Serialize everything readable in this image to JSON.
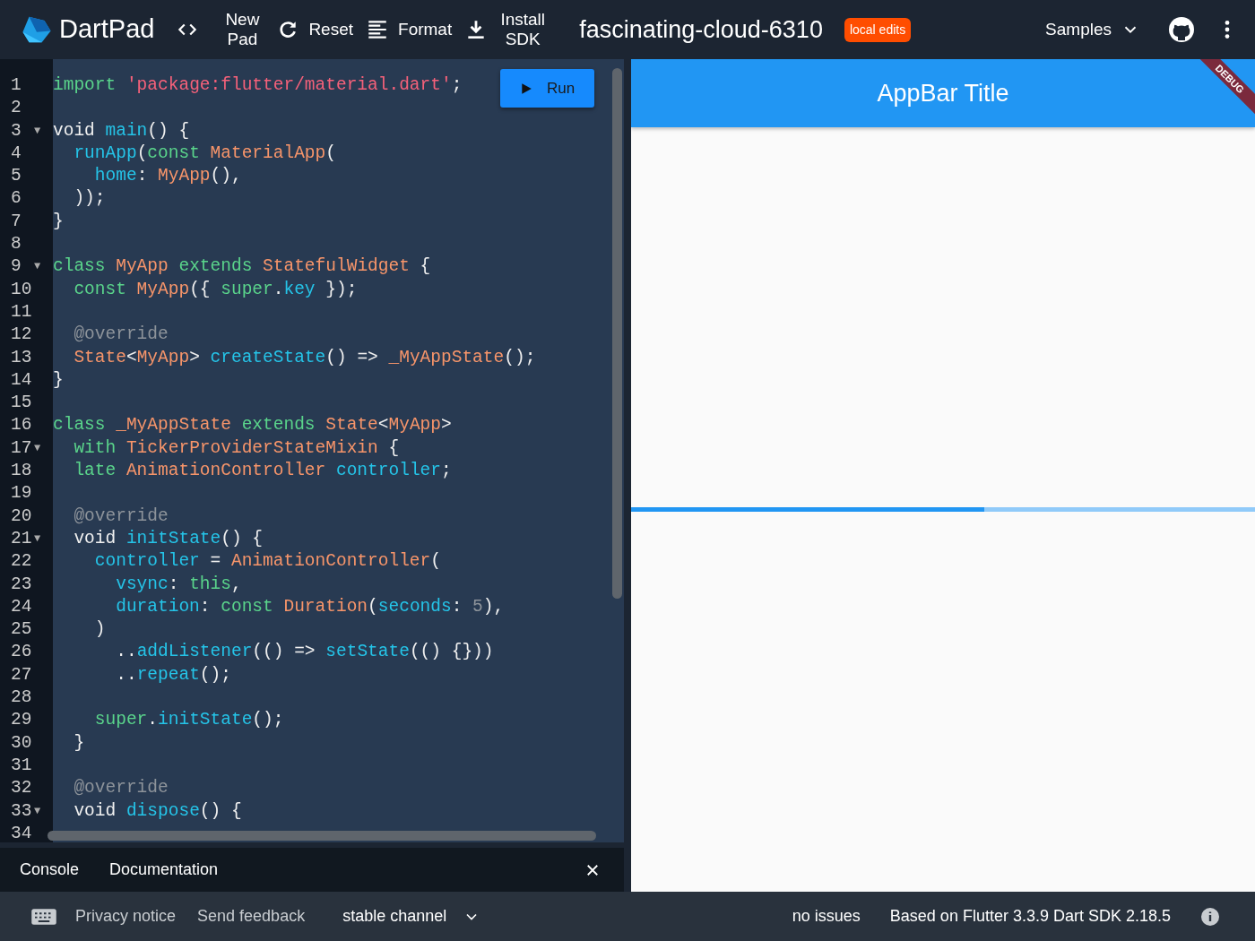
{
  "header": {
    "logo_text": "DartPad",
    "tools": [
      {
        "kind": "code",
        "label": "New Pad"
      },
      {
        "kind": "reset",
        "label": "Reset"
      },
      {
        "kind": "format",
        "label": "Format"
      },
      {
        "kind": "download",
        "label": "Install SDK"
      }
    ],
    "pad_name": "fascinating-cloud-6310",
    "badge": "local edits",
    "samples": "Samples"
  },
  "editor": {
    "run_button": "Run",
    "lines": [
      {
        "number": "1",
        "tokens": [
          {
            "text": "import",
            "kind": "k"
          },
          {
            "text": " 'package:flutter/material.dart'",
            "kind": "s"
          },
          {
            "text": ";",
            "kind": "p"
          }
        ]
      },
      {
        "number": "2"
      },
      {
        "number": "3",
        "fold": "▼",
        "tokens": [
          {
            "text": "void ",
            "kind": "p"
          },
          {
            "text": "main",
            "kind": "f"
          },
          {
            "text": "() {",
            "kind": "p"
          }
        ]
      },
      {
        "number": "4",
        "tokens": [
          {
            "text": "  runApp",
            "kind": "f"
          },
          {
            "text": "(",
            "kind": "p"
          },
          {
            "text": "const",
            "kind": "k"
          },
          {
            "text": " MaterialApp",
            "kind": "t"
          },
          {
            "text": "(",
            "kind": "p"
          }
        ]
      },
      {
        "number": "5",
        "tokens": [
          {
            "text": "    home",
            "kind": "f"
          },
          {
            "text": ": ",
            "kind": "p"
          },
          {
            "text": "MyApp",
            "kind": "t"
          },
          {
            "text": "(),",
            "kind": "p"
          }
        ]
      },
      {
        "number": "6",
        "tokens": [
          {
            "text": "  ));",
            "kind": "p"
          }
        ]
      },
      {
        "number": "7",
        "tokens": [
          {
            "text": "}",
            "kind": "p"
          }
        ]
      },
      {
        "number": "8"
      },
      {
        "number": "9",
        "fold": "▼",
        "tokens": [
          {
            "text": "class",
            "kind": "k"
          },
          {
            "text": " MyApp",
            "kind": "t"
          },
          {
            "text": " extends",
            "kind": "k"
          },
          {
            "text": " StatefulWidget",
            "kind": "t"
          },
          {
            "text": " {",
            "kind": "p"
          }
        ]
      },
      {
        "number": "10",
        "tokens": [
          {
            "text": "  const",
            "kind": "k"
          },
          {
            "text": " MyApp",
            "kind": "t"
          },
          {
            "text": "({ ",
            "kind": "p"
          },
          {
            "text": "super",
            "kind": "k"
          },
          {
            "text": ".",
            "kind": "p"
          },
          {
            "text": "key",
            "kind": "f"
          },
          {
            "text": " });",
            "kind": "p"
          }
        ]
      },
      {
        "number": "11"
      },
      {
        "number": "12",
        "tokens": [
          {
            "text": "  @override",
            "kind": "c"
          }
        ]
      },
      {
        "number": "13",
        "tokens": [
          {
            "text": "  State",
            "kind": "t"
          },
          {
            "text": "<",
            "kind": "p"
          },
          {
            "text": "MyApp",
            "kind": "t"
          },
          {
            "text": "> ",
            "kind": "p"
          },
          {
            "text": "createState",
            "kind": "f"
          },
          {
            "text": "() => ",
            "kind": "p"
          },
          {
            "text": "_MyAppState",
            "kind": "t"
          },
          {
            "text": "();",
            "kind": "p"
          }
        ]
      },
      {
        "number": "14",
        "tokens": [
          {
            "text": "}",
            "kind": "p"
          }
        ]
      },
      {
        "number": "15"
      },
      {
        "number": "16",
        "tokens": [
          {
            "text": "class",
            "kind": "k"
          },
          {
            "text": " _MyAppState",
            "kind": "t"
          },
          {
            "text": " extends",
            "kind": "k"
          },
          {
            "text": " State",
            "kind": "t"
          },
          {
            "text": "<",
            "kind": "p"
          },
          {
            "text": "MyApp",
            "kind": "t"
          },
          {
            "text": ">",
            "kind": "p"
          }
        ]
      },
      {
        "number": "17",
        "fold": "▼",
        "tokens": [
          {
            "text": "  with",
            "kind": "k"
          },
          {
            "text": " TickerProviderStateMixin",
            "kind": "t"
          },
          {
            "text": " {",
            "kind": "p"
          }
        ]
      },
      {
        "number": "18",
        "tokens": [
          {
            "text": "  late",
            "kind": "k"
          },
          {
            "text": " AnimationController",
            "kind": "t"
          },
          {
            "text": " controller",
            "kind": "f"
          },
          {
            "text": ";",
            "kind": "p"
          }
        ]
      },
      {
        "number": "19"
      },
      {
        "number": "20",
        "tokens": [
          {
            "text": "  @override",
            "kind": "c"
          }
        ]
      },
      {
        "number": "21",
        "fold": "▼",
        "tokens": [
          {
            "text": "  void ",
            "kind": "p"
          },
          {
            "text": "initState",
            "kind": "f"
          },
          {
            "text": "() {",
            "kind": "p"
          }
        ]
      },
      {
        "number": "22",
        "tokens": [
          {
            "text": "    controller",
            "kind": "f"
          },
          {
            "text": " = ",
            "kind": "p"
          },
          {
            "text": "AnimationController",
            "kind": "t"
          },
          {
            "text": "(",
            "kind": "p"
          }
        ]
      },
      {
        "number": "23",
        "tokens": [
          {
            "text": "      vsync",
            "kind": "f"
          },
          {
            "text": ": ",
            "kind": "p"
          },
          {
            "text": "this",
            "kind": "k"
          },
          {
            "text": ",",
            "kind": "p"
          }
        ]
      },
      {
        "number": "24",
        "tokens": [
          {
            "text": "      duration",
            "kind": "f"
          },
          {
            "text": ": ",
            "kind": "p"
          },
          {
            "text": "const",
            "kind": "k"
          },
          {
            "text": " Duration",
            "kind": "t"
          },
          {
            "text": "(",
            "kind": "p"
          },
          {
            "text": "seconds",
            "kind": "f"
          },
          {
            "text": ": ",
            "kind": "p"
          },
          {
            "text": "5",
            "kind": "n"
          },
          {
            "text": "),",
            "kind": "p"
          }
        ]
      },
      {
        "number": "25",
        "tokens": [
          {
            "text": "    )",
            "kind": "p"
          }
        ]
      },
      {
        "number": "26",
        "tokens": [
          {
            "text": "      ..",
            "kind": "p"
          },
          {
            "text": "addListener",
            "kind": "f"
          },
          {
            "text": "(() => ",
            "kind": "p"
          },
          {
            "text": "setState",
            "kind": "f"
          },
          {
            "text": "(() {}))",
            "kind": "p"
          }
        ]
      },
      {
        "number": "27",
        "tokens": [
          {
            "text": "      ..",
            "kind": "p"
          },
          {
            "text": "repeat",
            "kind": "f"
          },
          {
            "text": "();",
            "kind": "p"
          }
        ]
      },
      {
        "number": "28"
      },
      {
        "number": "29",
        "tokens": [
          {
            "text": "    super",
            "kind": "k"
          },
          {
            "text": ".",
            "kind": "p"
          },
          {
            "text": "initState",
            "kind": "f"
          },
          {
            "text": "();",
            "kind": "p"
          }
        ]
      },
      {
        "number": "30",
        "tokens": [
          {
            "text": "  }",
            "kind": "p"
          }
        ]
      },
      {
        "number": "31"
      },
      {
        "number": "32",
        "tokens": [
          {
            "text": "  @override",
            "kind": "c"
          }
        ]
      },
      {
        "number": "33",
        "fold": "▼",
        "tokens": [
          {
            "text": "  void ",
            "kind": "p"
          },
          {
            "text": "dispose",
            "kind": "f"
          },
          {
            "text": "() {",
            "kind": "p"
          }
        ]
      },
      {
        "number": "34"
      }
    ]
  },
  "preview": {
    "appbar_title": "AppBar Title",
    "banner": "DEBUG",
    "progress": {
      "level": 0.566
    }
  },
  "console": {
    "tabs": [
      "Console",
      "Documentation"
    ]
  },
  "footer": {
    "links": [
      "Privacy notice",
      "Send feedback"
    ],
    "channel": "stable channel",
    "status": "no issues",
    "version": "Based on Flutter 3.3.9 Dart SDK 2.18.5"
  }
}
